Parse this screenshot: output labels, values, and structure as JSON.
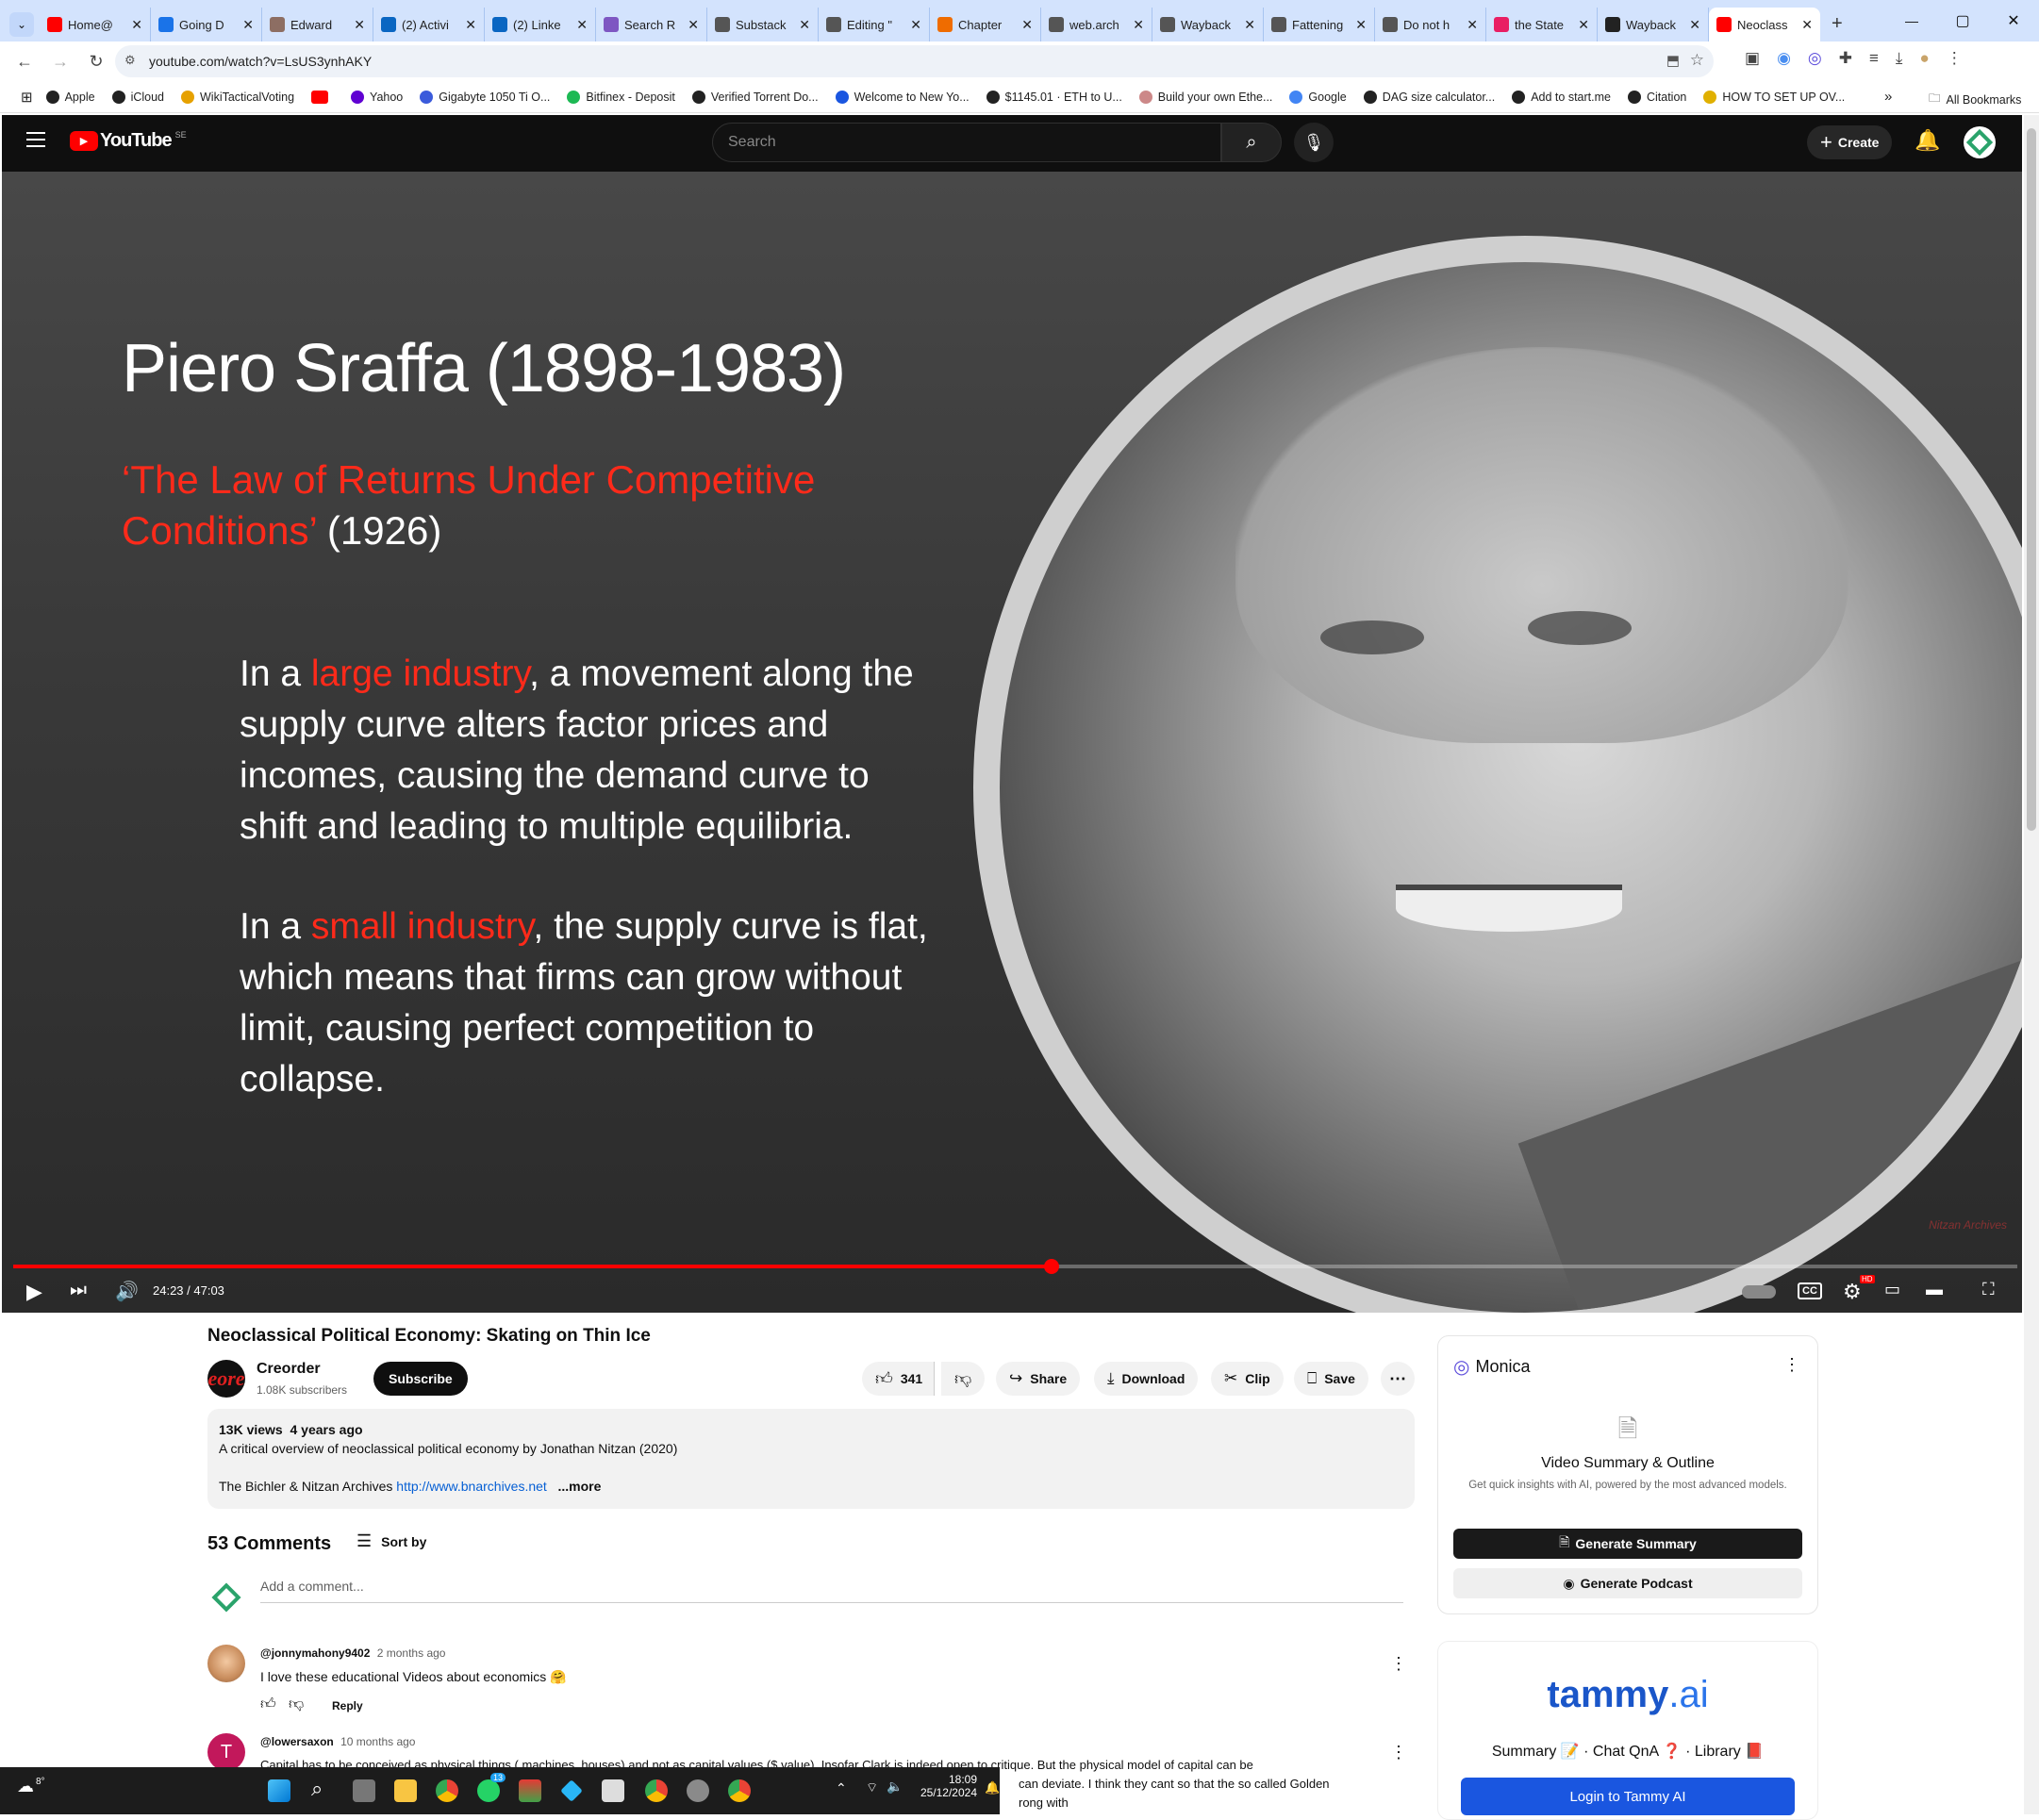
{
  "browser": {
    "tabs": [
      {
        "label": "Home@",
        "color": "#ff0000"
      },
      {
        "label": "Going D",
        "color": "#1a73e8"
      },
      {
        "label": "Edward",
        "color": "#8d6e63"
      },
      {
        "label": "(2) Activi",
        "color": "#0a66c2"
      },
      {
        "label": "(2) Linke",
        "color": "#0a66c2"
      },
      {
        "label": "Search R",
        "color": "#7e57c2"
      },
      {
        "label": "Substack",
        "color": "#555555"
      },
      {
        "label": "Editing \"",
        "color": "#555555"
      },
      {
        "label": "Chapter",
        "color": "#ef6c00"
      },
      {
        "label": "web.arch",
        "color": "#555555"
      },
      {
        "label": "Wayback",
        "color": "#555555"
      },
      {
        "label": "Fattening",
        "color": "#555555"
      },
      {
        "label": "Do not h",
        "color": "#555555"
      },
      {
        "label": "the State",
        "color": "#e91e63"
      },
      {
        "label": "Wayback",
        "color": "#222222"
      },
      {
        "label": "Neoclass",
        "color": "#ff0000"
      }
    ],
    "new_tab": "+",
    "window_controls": {
      "minimize": "—",
      "maximize": "▢",
      "close": "✕"
    },
    "url": "youtube.com/watch?v=LsUS3ynhAKY",
    "bookmarks": [
      "Apple",
      "iCloud",
      "WikiTacticalVoting",
      "",
      "Yahoo",
      "Gigabyte 1050 Ti O...",
      "Bitfinex - Deposit",
      "Verified Torrent Do...",
      "Welcome to New Yo...",
      "$1145.01 · ETH to U...",
      "Build your own Ethe...",
      "Google",
      "DAG size calculator...",
      "Add to start.me",
      "Citation",
      "HOW TO SET UP OV..."
    ],
    "all_bookmarks": "All Bookmarks",
    "more_bookmarks": "»"
  },
  "youtube": {
    "logo": "YouTube",
    "region": "SE",
    "search_placeholder": "Search",
    "create": "Create"
  },
  "slide": {
    "title": "Piero Sraffa (1898-1983)",
    "subtitle_red": "‘The Law of Returns Under Competitive Conditions’",
    "subtitle_year": "(1926)",
    "p1_pre": "In a ",
    "p1_red": "large industry",
    "p1_post": ", a movement along the supply curve alters factor prices and incomes, causing the demand curve to shift and leading to multiple equilibria.",
    "p2_pre": "In a ",
    "p2_red": "small industry",
    "p2_post": ", the supply curve is flat, which means that firms can grow without limit, causing perfect competition to collapse.",
    "watermark": "Nitzan Archives"
  },
  "player": {
    "time": "24:23 / 47:03",
    "progress": 0.518,
    "cc": "CC",
    "hd": "HD"
  },
  "video": {
    "title": "Neoclassical Political Economy: Skating on Thin Ice",
    "channel": "Creorder",
    "channel_avatar_text": "eore",
    "subscribers": "1.08K subscribers",
    "subscribe": "Subscribe",
    "likes": "341",
    "share": "Share",
    "download": "Download",
    "clip": "Clip",
    "save": "Save",
    "views": "13K views",
    "age": "4 years ago",
    "desc_line1": "A critical overview of neoclassical political economy by Jonathan Nitzan (2020)",
    "desc_line2_pre": "The Bichler & Nitzan Archives ",
    "desc_link": "http://www.bnarchives.net",
    "more": "...more"
  },
  "comments": {
    "count": "53 Comments",
    "sort": "Sort by",
    "add_placeholder": "Add a comment...",
    "items": [
      {
        "user": "@jonnymahony9402",
        "age": "2 months ago",
        "text": "I love these educational Videos about economics 🤗",
        "reply": "Reply"
      },
      {
        "user": "@lowersaxon",
        "age": "10 months ago",
        "avatar": "T",
        "text": "Capital has to be conceived as physical things ( machines, houses) and not as capital values ($ value). Insofar Clark is indeed open to critique. But the physical model of capital can be",
        "text2": "can deviate. I think they cant so that the so called Golden",
        "text3": "rong with"
      }
    ]
  },
  "monica": {
    "name": "Monica",
    "heading": "Video Summary & Outline",
    "sub": "Get quick insights with AI, powered by the most advanced models.",
    "btn1": "Generate Summary",
    "btn2": "Generate Podcast"
  },
  "tammy": {
    "logo1": "tammy",
    "logo2": ".ai",
    "features": "Summary 📝 · Chat QnA ❓ · Library 📕",
    "login": "Login to Tammy AI"
  },
  "taskbar": {
    "weather": "8°",
    "time": "18:09",
    "date": "25/12/2024",
    "badge": "13"
  }
}
